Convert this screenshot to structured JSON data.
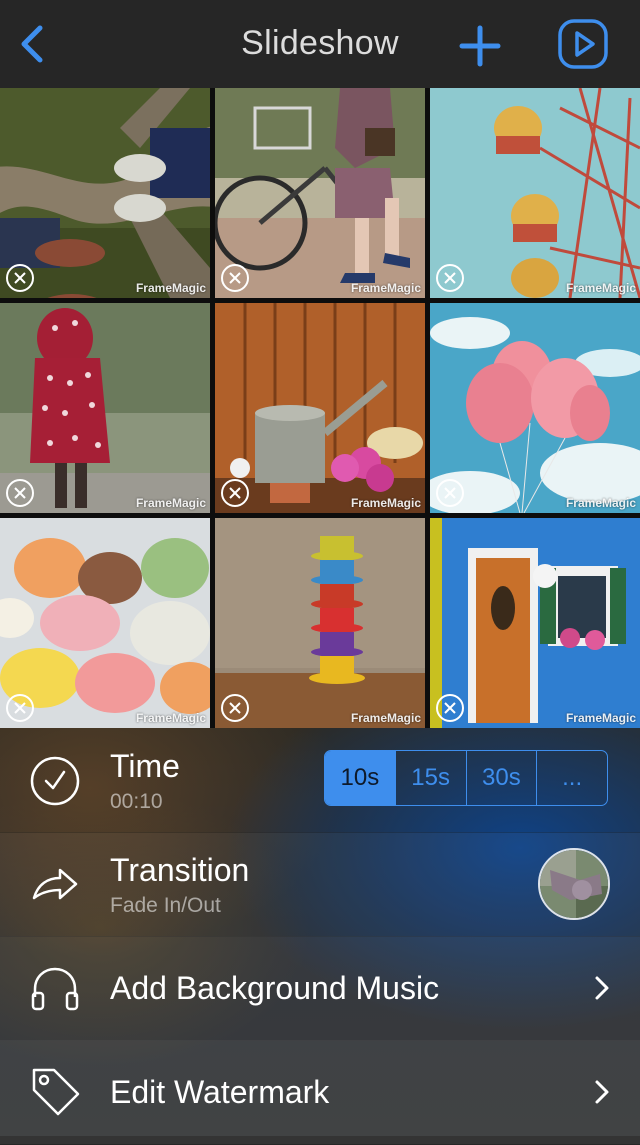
{
  "header": {
    "title": "Slideshow",
    "back_icon": "chevron-left-icon",
    "add_icon": "plus-icon",
    "play_icon": "play-circle-icon",
    "accent_color": "#3e8eed"
  },
  "grid": {
    "watermark": "FrameMagic",
    "remove_icon": "close-circle-icon",
    "photos": [
      {
        "subject": "shoes on tree roots"
      },
      {
        "subject": "girl with bicycle"
      },
      {
        "subject": "ferris wheel"
      },
      {
        "subject": "child in red polka dot raincoat"
      },
      {
        "subject": "watering can and flowers"
      },
      {
        "subject": "pink balloons in sky"
      },
      {
        "subject": "macarons"
      },
      {
        "subject": "stacked coffee cups"
      },
      {
        "subject": "blue house with door"
      }
    ]
  },
  "settings": {
    "time": {
      "label": "Time",
      "value": "00:10",
      "icon": "clock-icon",
      "options": [
        "10s",
        "15s",
        "30s",
        "..."
      ],
      "selected": "10s"
    },
    "transition": {
      "label": "Transition",
      "value": "Fade In/Out",
      "icon": "share-arrow-icon"
    },
    "music": {
      "label": "Add Background Music",
      "icon": "headphones-icon"
    },
    "watermark": {
      "label": "Edit Watermark",
      "icon": "tag-icon"
    }
  }
}
